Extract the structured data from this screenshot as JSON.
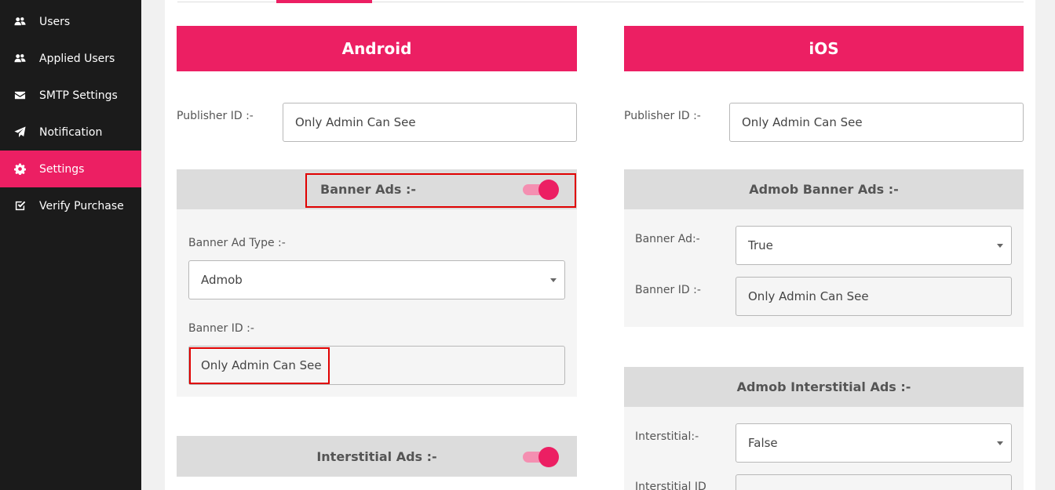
{
  "sidebar": {
    "items": [
      {
        "label": "Users",
        "icon": "users-icon"
      },
      {
        "label": "Applied Users",
        "icon": "users-icon"
      },
      {
        "label": "SMTP Settings",
        "icon": "envelope-icon"
      },
      {
        "label": "Notification",
        "icon": "paper-plane-icon"
      },
      {
        "label": "Settings",
        "icon": "gear-icon",
        "active": true
      },
      {
        "label": "Verify Purchase",
        "icon": "check-square-icon"
      }
    ]
  },
  "android": {
    "title": "Android",
    "publisher_label": "Publisher ID :-",
    "publisher_value": "Only Admin Can See",
    "banner": {
      "header": "Banner Ads :-",
      "enabled": true,
      "type_label": "Banner Ad Type :-",
      "type_value": "Admob",
      "id_label": "Banner ID :-",
      "id_value": "Only Admin Can See"
    },
    "interstitial": {
      "header": "Interstitial Ads :-",
      "enabled": true
    }
  },
  "ios": {
    "title": "iOS",
    "publisher_label": "Publisher ID :-",
    "publisher_value": "Only Admin Can See",
    "banner": {
      "header": "Admob Banner Ads :-",
      "ad_label": "Banner Ad:-",
      "ad_value": "True",
      "id_label": "Banner ID :-",
      "id_value": "Only Admin Can See"
    },
    "interstitial": {
      "header": "Admob Interstitial Ads :-",
      "ad_label": "Interstitial:-",
      "ad_value": "False",
      "id_label": "Interstitial ID"
    }
  },
  "colors": {
    "accent": "#ec1f63",
    "sidebar_bg": "#1b1b1b",
    "highlight": "#e00000"
  }
}
